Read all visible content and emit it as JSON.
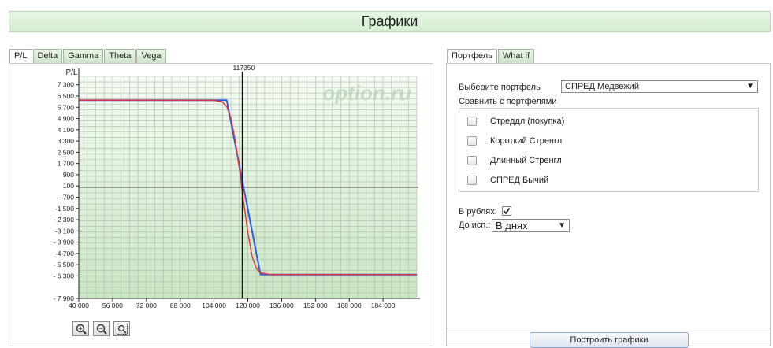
{
  "page": {
    "title": "Графики"
  },
  "left_tabs": [
    {
      "label": "P/L",
      "active": true
    },
    {
      "label": "Delta",
      "active": false
    },
    {
      "label": "Gamma",
      "active": false
    },
    {
      "label": "Theta",
      "active": false
    },
    {
      "label": "Vega",
      "active": false
    }
  ],
  "right_tabs": [
    {
      "label": "Портфель",
      "active": true
    },
    {
      "label": "What if",
      "active": false
    }
  ],
  "chart": {
    "watermark": "option.ru",
    "ylabel": "P/L",
    "marker_label": "117350"
  },
  "chart_data": {
    "type": "line",
    "ylabel": "P/L",
    "xlim": [
      40000,
      200000
    ],
    "ylim": [
      -7900,
      7900
    ],
    "x_ticks": [
      40000,
      56000,
      72000,
      88000,
      104000,
      120000,
      136000,
      152000,
      168000,
      184000
    ],
    "x_tick_labels": [
      "40 000",
      "56 000",
      "72 000",
      "88 000",
      "104 000",
      "120 000",
      "136 000",
      "152 000",
      "168 000",
      "184 000"
    ],
    "y_ticks": [
      7300,
      6500,
      5700,
      4900,
      4100,
      3300,
      2500,
      1700,
      900,
      100,
      -700,
      -1500,
      -2300,
      -3100,
      -3900,
      -4700,
      -5500,
      -6300,
      -7900
    ],
    "y_tick_labels": [
      "7 300",
      "6 500",
      "5 700",
      "4 900",
      "4 100",
      "3 300",
      "2 500",
      "1 700",
      "900",
      "100",
      "- 700",
      "-1 500",
      "- 2 300",
      "-3 100",
      "- 3 900",
      "-4 700",
      "- 5 500",
      "- 6 300",
      "- 7 900"
    ],
    "marker_x": 117350,
    "grid": true,
    "series": [
      {
        "color": "#2e5be0",
        "x": [
          40000,
          110000,
          126000,
          200000
        ],
        "y": [
          6200,
          6200,
          -6200,
          -6200
        ]
      },
      {
        "color": "#e0343a",
        "x": [
          40000,
          104000,
          108000,
          110000,
          112000,
          114000,
          116000,
          118000,
          120000,
          122000,
          124000,
          126000,
          130000,
          200000
        ],
        "y": [
          6200,
          6190,
          6080,
          5750,
          4900,
          3400,
          1300,
          -1000,
          -3200,
          -4900,
          -5750,
          -6080,
          -6190,
          -6200
        ]
      }
    ]
  },
  "portfolio": {
    "select_label": "Выберите портфель",
    "select_value": "СПРЕД Медвежий",
    "compare_label": "Сравнить с портфелями",
    "compare_items": [
      "Стреддл (покупка)",
      "Короткий Стренгл",
      "Длинный Стренгл",
      "СПРЕД Бычий"
    ],
    "rubles_label": "В рублях:",
    "rubles_checked": true,
    "expiry_label": "До исп.:",
    "expiry_value": "В днях",
    "bottom_button": "Построить графики"
  }
}
